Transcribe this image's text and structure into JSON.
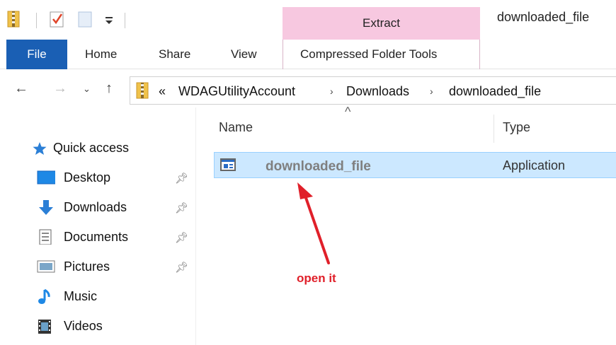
{
  "window": {
    "title": "downloaded_file"
  },
  "ribbon": {
    "context_group": "Extract",
    "tabs": [
      "File",
      "Home",
      "Share",
      "View",
      "Compressed Folder Tools"
    ]
  },
  "address_bar": {
    "overflow": "«",
    "crumbs": [
      "WDAGUtilityAccount",
      "Downloads",
      "downloaded_file"
    ]
  },
  "nav_pane": {
    "items": [
      {
        "label": "Quick access",
        "icon": "star-icon",
        "pinned": false
      },
      {
        "label": "Desktop",
        "icon": "desktop-icon",
        "pinned": true
      },
      {
        "label": "Downloads",
        "icon": "download-icon",
        "pinned": true
      },
      {
        "label": "Documents",
        "icon": "documents-icon",
        "pinned": true
      },
      {
        "label": "Pictures",
        "icon": "pictures-icon",
        "pinned": true
      },
      {
        "label": "Music",
        "icon": "music-icon",
        "pinned": false
      },
      {
        "label": "Videos",
        "icon": "videos-icon",
        "pinned": false
      }
    ]
  },
  "file_list": {
    "columns": [
      "Name",
      "Type"
    ],
    "rows": [
      {
        "name": "downloaded_file",
        "type": "Application",
        "selected": true
      }
    ]
  },
  "annotation": {
    "text": "open it",
    "color": "#e0202a"
  },
  "colors": {
    "file_tab": "#1a5fb4",
    "context_tab": "#f7c8e0",
    "selection": "#cce8ff"
  }
}
